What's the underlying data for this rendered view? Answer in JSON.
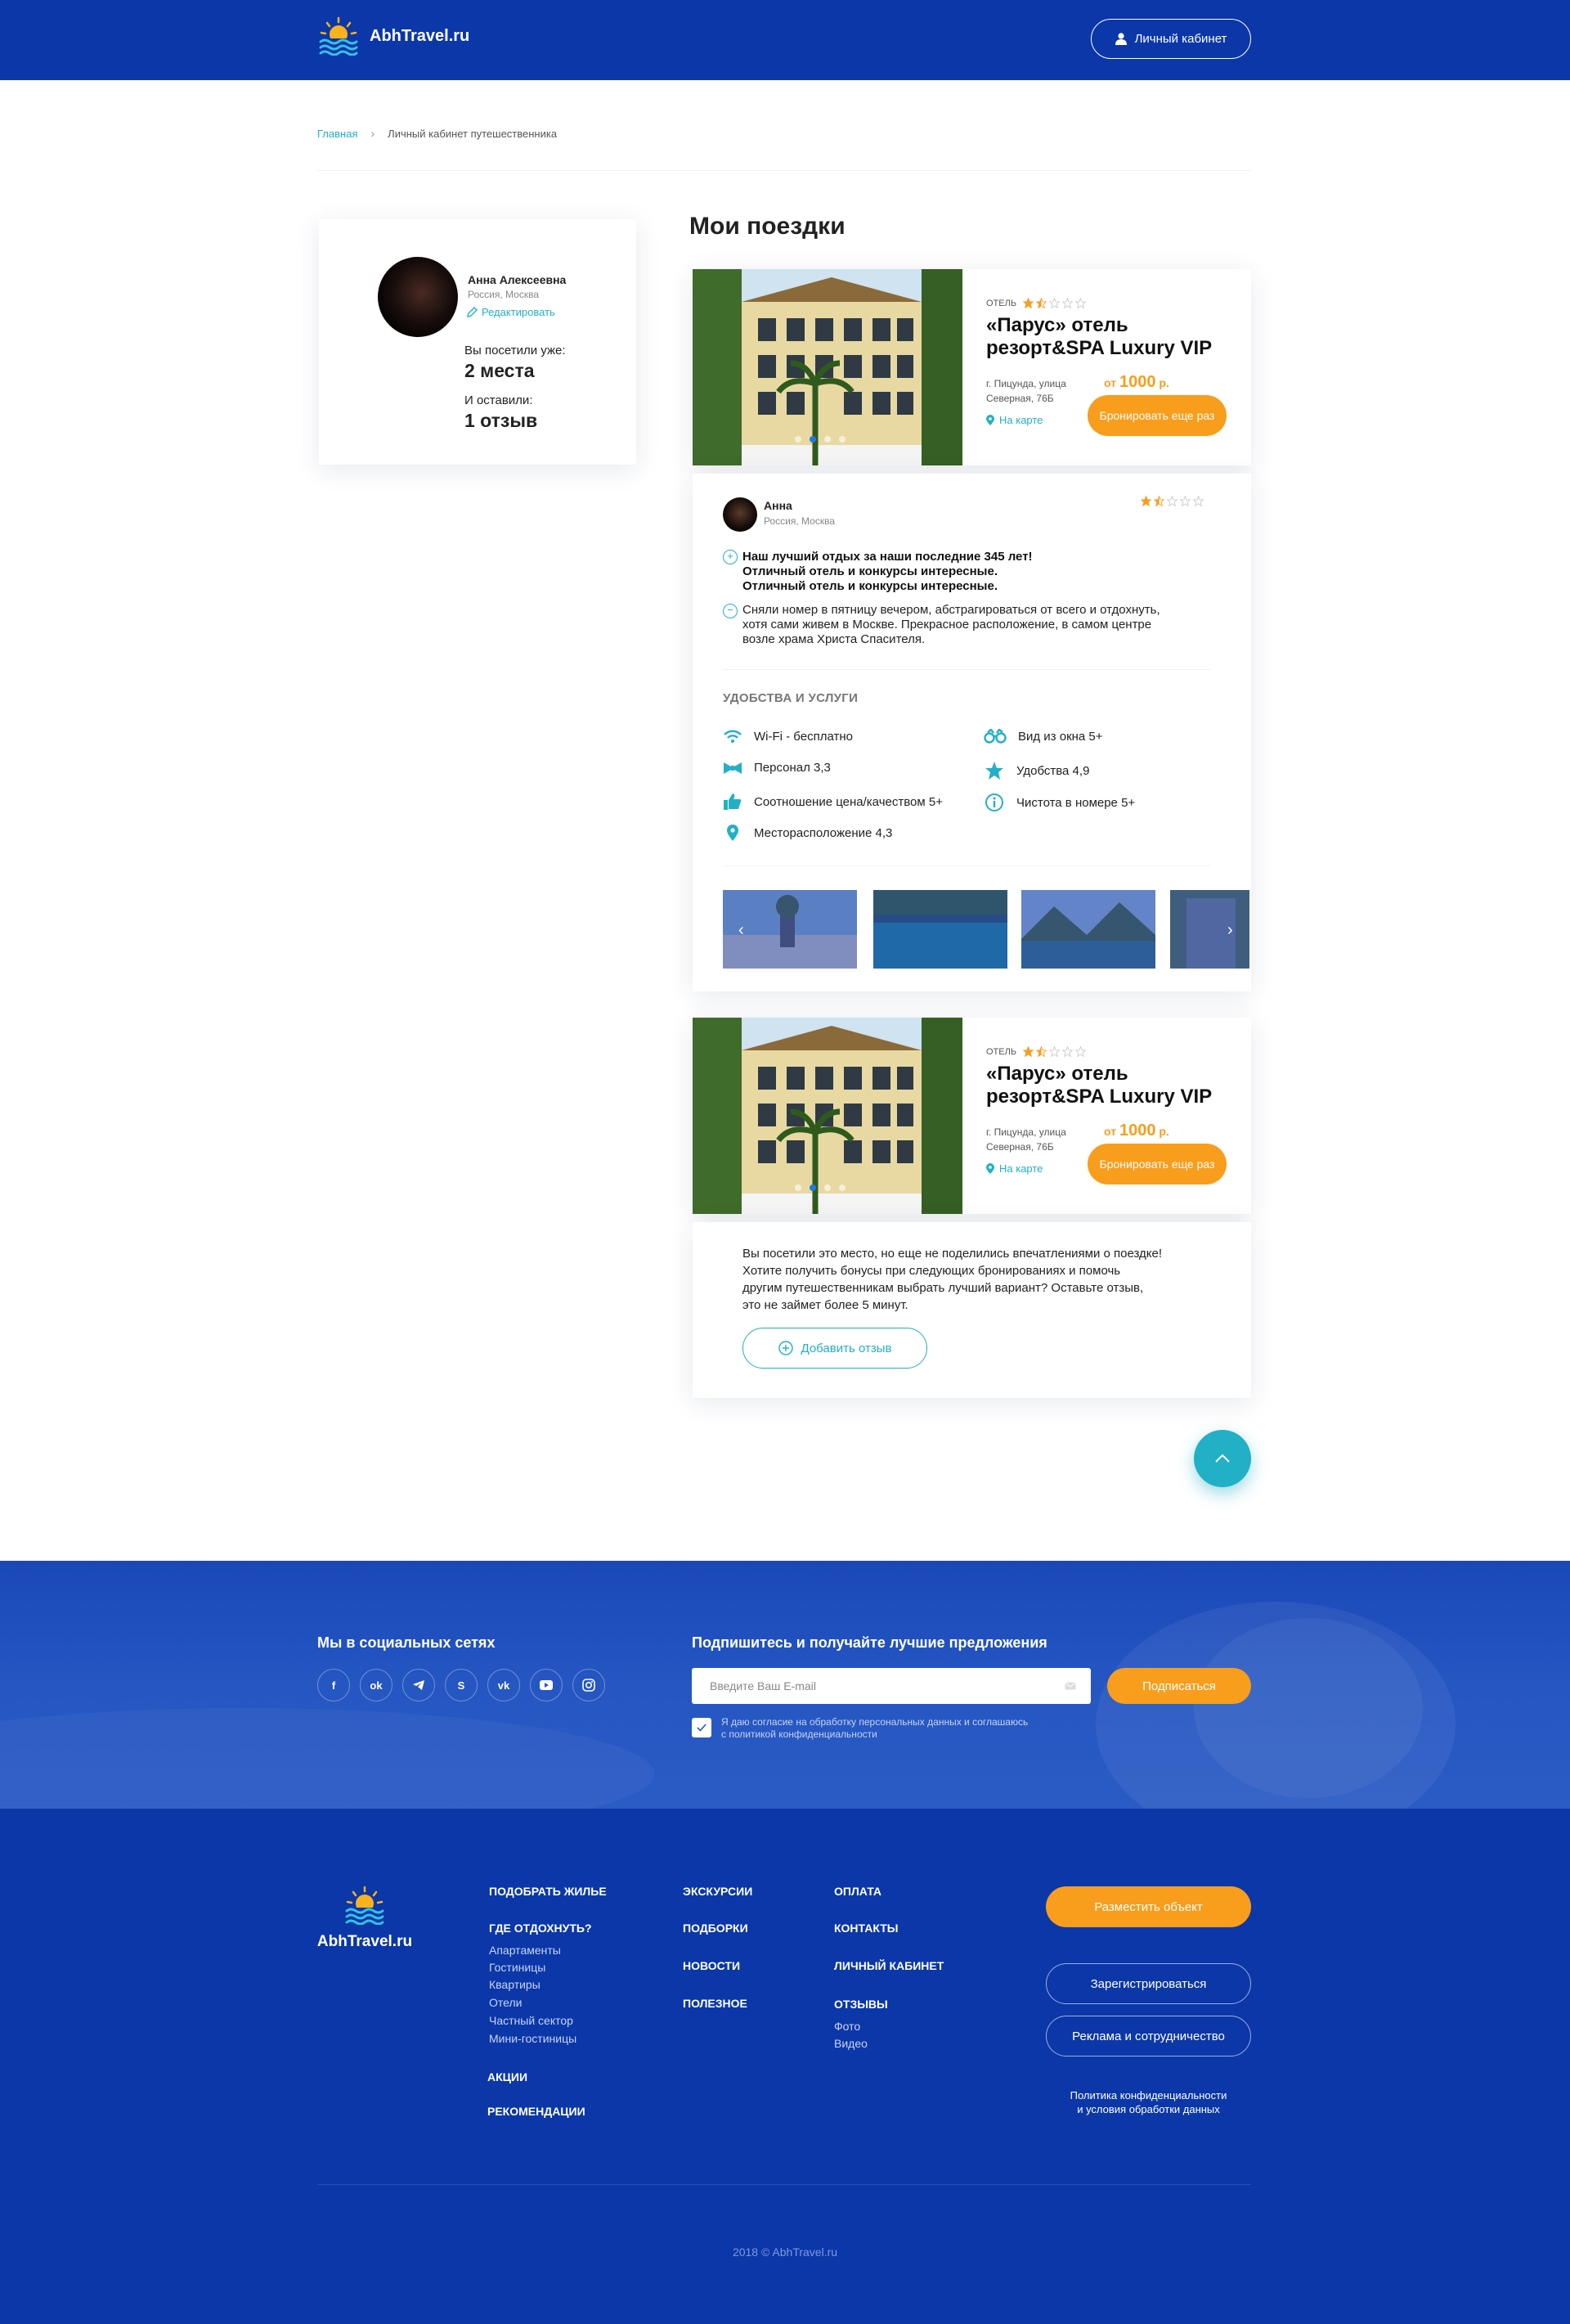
{
  "header": {
    "logo": "AbhTravel.ru",
    "cabinet_button": "Личный кабинет"
  },
  "breadcrumb": {
    "home": "Главная",
    "current": "Личный кабинет путешественника"
  },
  "profile": {
    "name": "Анна Алексеевна",
    "location": "Россия, Москва",
    "edit": "Редактировать",
    "visited_label": "Вы посетили уже:",
    "visited_value": "2 места",
    "reviews_label": "И оставили:",
    "reviews_value": "1 отзыв"
  },
  "page_title": "Мои поездки",
  "trips": [
    {
      "type": "ОТЕЛЬ",
      "rating": 1.5,
      "title_line1": "«Парус» отель",
      "title_line2": "резорт&SPA Luxury VIP",
      "address_line1": "г. Пицунда, улица",
      "address_line2": "Северная, 76Б",
      "map_link": "На карте",
      "price_prefix": "от",
      "price_value": "1000",
      "price_unit": "р.",
      "book_button": "Бронировать еще раз"
    },
    {
      "type": "ОТЕЛЬ",
      "rating": 1.5,
      "title_line1": "«Парус» отель",
      "title_line2": "резорт&SPA Luxury VIP",
      "address_line1": "г. Пицунда, улица",
      "address_line2": "Северная, 76Б",
      "map_link": "На карте",
      "price_prefix": "от",
      "price_value": "1000",
      "price_unit": "р.",
      "book_button": "Бронировать еще раз"
    }
  ],
  "review": {
    "author": "Анна",
    "location": "Россия, Москва",
    "rating": 1.5,
    "positive_line1": "Наш лучший отдых за наши последние 345 лет!",
    "positive_line2": "Отличный отель и конкурсы интересные.",
    "positive_line3": "Отличный отель и конкурсы интересные.",
    "negative_line1": "Сняли номер в пятницу вечером, абстрагироваться от всего и отдохнуть,",
    "negative_line2": "хотя сами живем в Москве. Прекрасное расположение, в самом центре",
    "negative_line3": "возле храма Христа Спасителя.",
    "amenities_title": "УДОБСТВА И УСЛУГИ",
    "amenities": [
      {
        "icon": "wifi-icon",
        "label": "Wi-Fi - бесплатно"
      },
      {
        "icon": "bowtie-icon",
        "label": "Персонал 3,3"
      },
      {
        "icon": "thumbs-up-icon",
        "label": "Соотношение цена/качеством 5+"
      },
      {
        "icon": "location-pin-icon",
        "label": "Месторасположение 4,3"
      },
      {
        "icon": "binoculars-icon",
        "label": "Вид из окна 5+"
      },
      {
        "icon": "star-icon",
        "label": "Удобства 4,9"
      },
      {
        "icon": "info-icon",
        "label": "Чистота в номере 5+"
      }
    ]
  },
  "no_review": {
    "line1": "Вы посетили это место, но еще не поделились впечатлениями о поездке!",
    "line2": "Хотите получить бонусы при следующих бронированиях и помочь",
    "line3": "другим путешественникам выбрать лучший вариант? Оставьте отзыв,",
    "line4": "это не займет более 5 минут.",
    "add_button": "Добавить отзыв"
  },
  "social": {
    "title": "Мы в социальных сетях",
    "networks": [
      "facebook-icon",
      "odnoklassniki-icon",
      "telegram-icon",
      "skype-icon",
      "vk-icon",
      "youtube-icon",
      "instagram-icon"
    ],
    "subscribe_title": "Подпишитесь и получайте лучшие предложения",
    "email_placeholder": "Введите Ваш E-mail",
    "subscribe_button": "Подписаться",
    "consent_line1": "Я даю согласие на обработку персональных данных и соглашаюсь",
    "consent_line2": "с политикой конфиденциальности"
  },
  "footer": {
    "logo": "AbhTravel.ru",
    "col1": {
      "h1": "ПОДОБРАТЬ ЖИЛЬЕ",
      "h2": "ГДЕ ОТДОХНУТЬ?",
      "links": [
        "Апартаменты",
        "Гостиницы",
        "Квартиры",
        "Отели",
        "Частный сектор",
        "Мини-гостиницы"
      ],
      "h3": "АКЦИИ",
      "h4": "РЕКОМЕНДАЦИИ"
    },
    "col2": [
      "ЭКСКУРСИИ",
      "ПОДБОРКИ",
      "НОВОСТИ",
      "ПОЛЕЗНОЕ"
    ],
    "col3": {
      "items": [
        "ОПЛАТА",
        "КОНТАКТЫ",
        "ЛИЧНЫЙ КАБИНЕТ",
        "ОТЗЫВЫ"
      ],
      "links": [
        "Фото",
        "Видео"
      ]
    },
    "place_button": "Разместить объект",
    "register_button": "Зарегистрироваться",
    "ads_button": "Реклама и сотрудничество",
    "policy_line1": "Политика конфиденциальности",
    "policy_line2": "и условия обработки данных",
    "copyright": "2018 © AbhTravel.ru"
  },
  "colors": {
    "brand_blue": "#0b37a8",
    "accent_orange": "#f99d1c",
    "accent_teal": "#21b0c6"
  }
}
